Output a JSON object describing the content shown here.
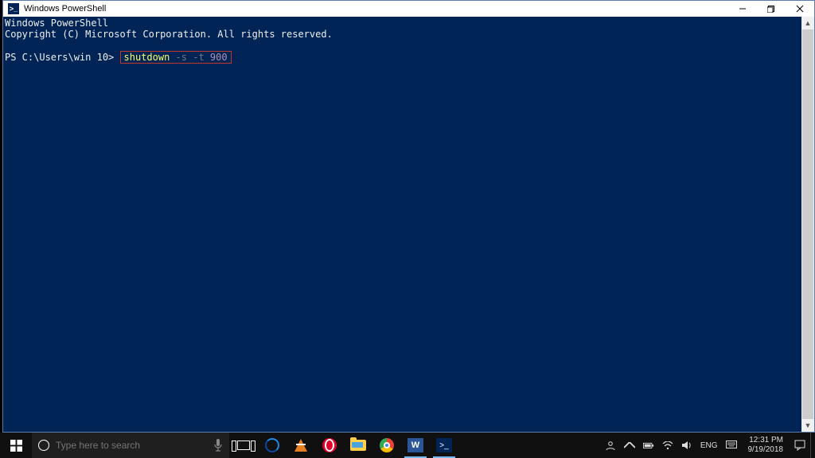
{
  "window": {
    "title": "Windows PowerShell",
    "icon_label": ">_"
  },
  "terminal": {
    "header_line1": "Windows PowerShell",
    "header_line2": "Copyright (C) Microsoft Corporation. All rights reserved.",
    "prompt": "PS C:\\Users\\win 10>",
    "command": "shutdown",
    "flag1": "-s",
    "flag2": "-t",
    "arg": "900"
  },
  "taskbar": {
    "search_placeholder": "Type here to search",
    "lang": "ENG",
    "time": "12:31 PM",
    "date": "9/19/2018"
  }
}
